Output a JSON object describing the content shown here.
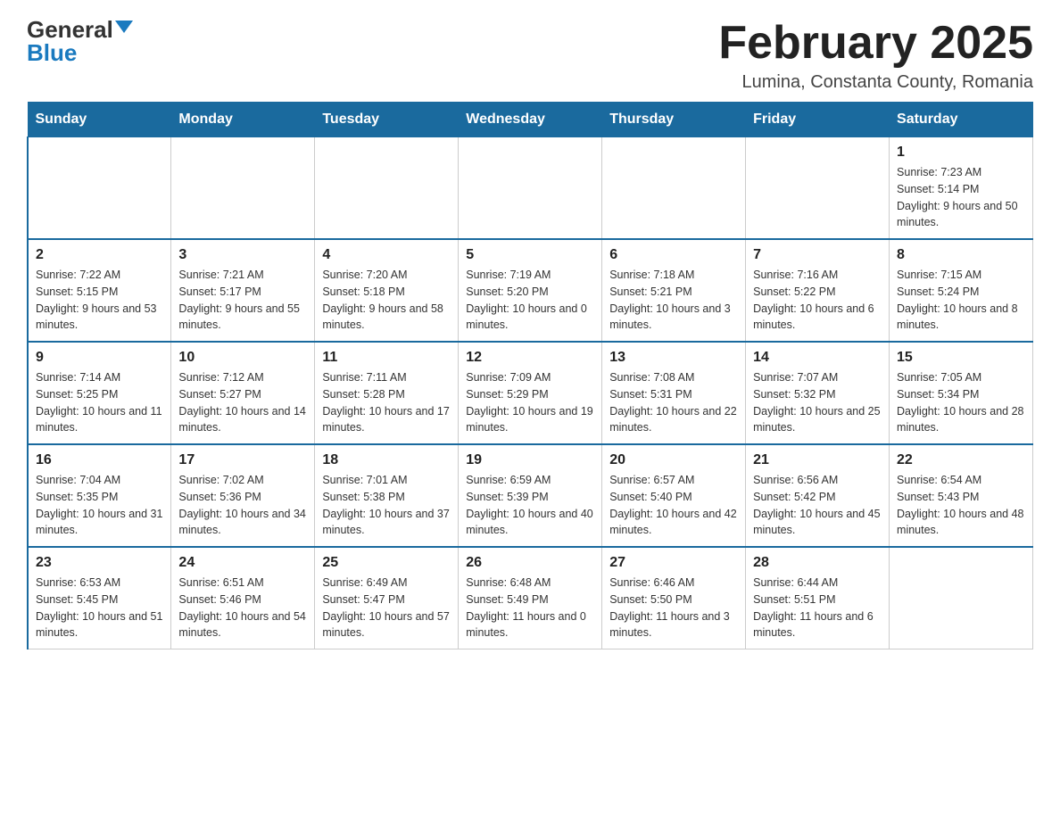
{
  "header": {
    "logo_general": "General",
    "logo_blue": "Blue",
    "title": "February 2025",
    "subtitle": "Lumina, Constanta County, Romania"
  },
  "days_of_week": [
    "Sunday",
    "Monday",
    "Tuesday",
    "Wednesday",
    "Thursday",
    "Friday",
    "Saturday"
  ],
  "weeks": [
    {
      "days": [
        {
          "number": "",
          "info": ""
        },
        {
          "number": "",
          "info": ""
        },
        {
          "number": "",
          "info": ""
        },
        {
          "number": "",
          "info": ""
        },
        {
          "number": "",
          "info": ""
        },
        {
          "number": "",
          "info": ""
        },
        {
          "number": "1",
          "info": "Sunrise: 7:23 AM\nSunset: 5:14 PM\nDaylight: 9 hours and 50 minutes."
        }
      ]
    },
    {
      "days": [
        {
          "number": "2",
          "info": "Sunrise: 7:22 AM\nSunset: 5:15 PM\nDaylight: 9 hours and 53 minutes."
        },
        {
          "number": "3",
          "info": "Sunrise: 7:21 AM\nSunset: 5:17 PM\nDaylight: 9 hours and 55 minutes."
        },
        {
          "number": "4",
          "info": "Sunrise: 7:20 AM\nSunset: 5:18 PM\nDaylight: 9 hours and 58 minutes."
        },
        {
          "number": "5",
          "info": "Sunrise: 7:19 AM\nSunset: 5:20 PM\nDaylight: 10 hours and 0 minutes."
        },
        {
          "number": "6",
          "info": "Sunrise: 7:18 AM\nSunset: 5:21 PM\nDaylight: 10 hours and 3 minutes."
        },
        {
          "number": "7",
          "info": "Sunrise: 7:16 AM\nSunset: 5:22 PM\nDaylight: 10 hours and 6 minutes."
        },
        {
          "number": "8",
          "info": "Sunrise: 7:15 AM\nSunset: 5:24 PM\nDaylight: 10 hours and 8 minutes."
        }
      ]
    },
    {
      "days": [
        {
          "number": "9",
          "info": "Sunrise: 7:14 AM\nSunset: 5:25 PM\nDaylight: 10 hours and 11 minutes."
        },
        {
          "number": "10",
          "info": "Sunrise: 7:12 AM\nSunset: 5:27 PM\nDaylight: 10 hours and 14 minutes."
        },
        {
          "number": "11",
          "info": "Sunrise: 7:11 AM\nSunset: 5:28 PM\nDaylight: 10 hours and 17 minutes."
        },
        {
          "number": "12",
          "info": "Sunrise: 7:09 AM\nSunset: 5:29 PM\nDaylight: 10 hours and 19 minutes."
        },
        {
          "number": "13",
          "info": "Sunrise: 7:08 AM\nSunset: 5:31 PM\nDaylight: 10 hours and 22 minutes."
        },
        {
          "number": "14",
          "info": "Sunrise: 7:07 AM\nSunset: 5:32 PM\nDaylight: 10 hours and 25 minutes."
        },
        {
          "number": "15",
          "info": "Sunrise: 7:05 AM\nSunset: 5:34 PM\nDaylight: 10 hours and 28 minutes."
        }
      ]
    },
    {
      "days": [
        {
          "number": "16",
          "info": "Sunrise: 7:04 AM\nSunset: 5:35 PM\nDaylight: 10 hours and 31 minutes."
        },
        {
          "number": "17",
          "info": "Sunrise: 7:02 AM\nSunset: 5:36 PM\nDaylight: 10 hours and 34 minutes."
        },
        {
          "number": "18",
          "info": "Sunrise: 7:01 AM\nSunset: 5:38 PM\nDaylight: 10 hours and 37 minutes."
        },
        {
          "number": "19",
          "info": "Sunrise: 6:59 AM\nSunset: 5:39 PM\nDaylight: 10 hours and 40 minutes."
        },
        {
          "number": "20",
          "info": "Sunrise: 6:57 AM\nSunset: 5:40 PM\nDaylight: 10 hours and 42 minutes."
        },
        {
          "number": "21",
          "info": "Sunrise: 6:56 AM\nSunset: 5:42 PM\nDaylight: 10 hours and 45 minutes."
        },
        {
          "number": "22",
          "info": "Sunrise: 6:54 AM\nSunset: 5:43 PM\nDaylight: 10 hours and 48 minutes."
        }
      ]
    },
    {
      "days": [
        {
          "number": "23",
          "info": "Sunrise: 6:53 AM\nSunset: 5:45 PM\nDaylight: 10 hours and 51 minutes."
        },
        {
          "number": "24",
          "info": "Sunrise: 6:51 AM\nSunset: 5:46 PM\nDaylight: 10 hours and 54 minutes."
        },
        {
          "number": "25",
          "info": "Sunrise: 6:49 AM\nSunset: 5:47 PM\nDaylight: 10 hours and 57 minutes."
        },
        {
          "number": "26",
          "info": "Sunrise: 6:48 AM\nSunset: 5:49 PM\nDaylight: 11 hours and 0 minutes."
        },
        {
          "number": "27",
          "info": "Sunrise: 6:46 AM\nSunset: 5:50 PM\nDaylight: 11 hours and 3 minutes."
        },
        {
          "number": "28",
          "info": "Sunrise: 6:44 AM\nSunset: 5:51 PM\nDaylight: 11 hours and 6 minutes."
        },
        {
          "number": "",
          "info": ""
        }
      ]
    }
  ]
}
